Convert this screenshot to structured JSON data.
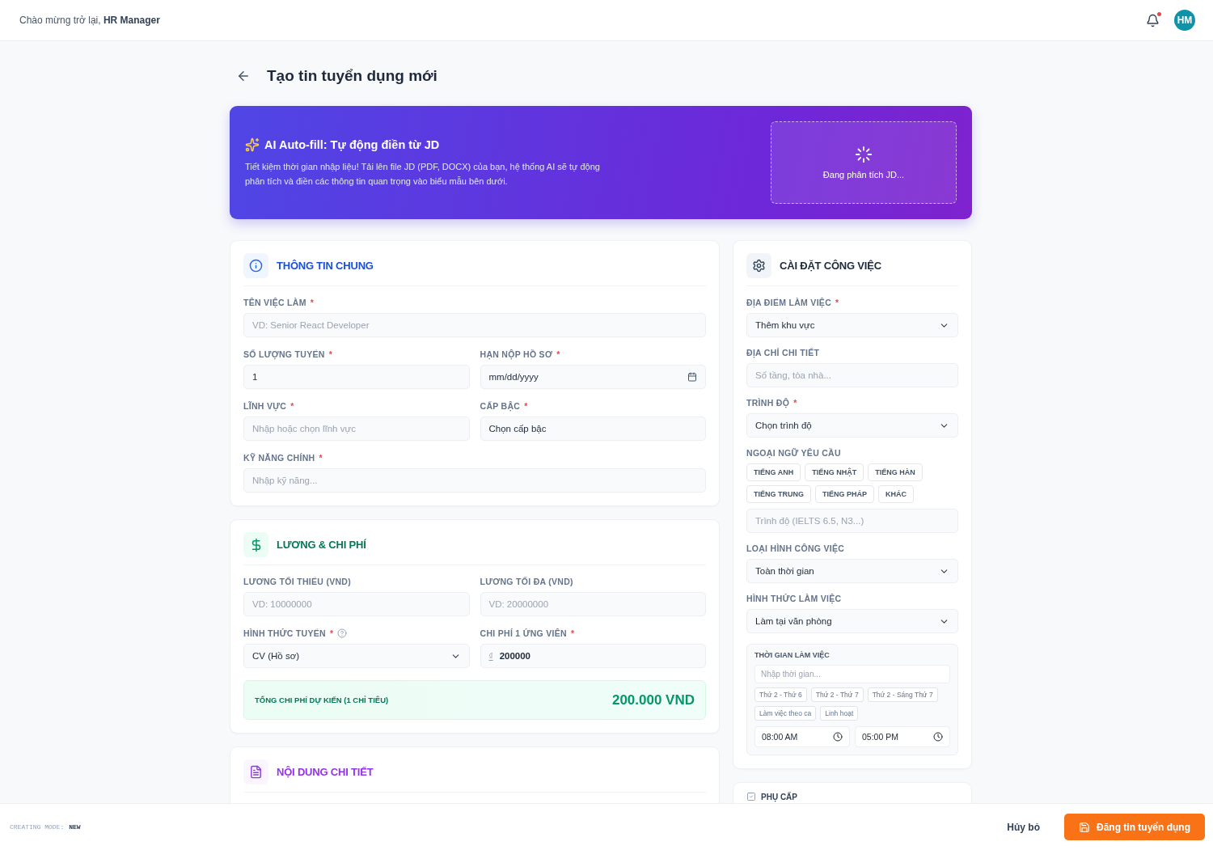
{
  "header": {
    "greeting": "Chào mừng trở lại, **HR Manager**",
    "has_notification": true,
    "avatar": "HM"
  },
  "page_title": "Tạo tin tuyển dụng mới",
  "ai_banner": {
    "title": "AI Auto-fill: Tự động điền từ JD",
    "description": "Tiết kiệm thời gian nhập liệu! Tải lên file JD (PDF, DOCX) của bạn, hệ thống AI sẽ tự động phân tích và điền các thông tin quan trọng vào biểu mẫu bên dưới.",
    "status": "Đang phân tích JD..."
  },
  "general": {
    "title": "THÔNG TIN CHUNG",
    "fields": [
      {
        "label": "TÊN VIỆC LÀM",
        "required_mark": "*",
        "kind": "text",
        "wide": true,
        "placeholder": "VD: Senior React Developer"
      },
      {
        "label": "SỐ LƯỢNG TUYỂN",
        "required_mark": "*",
        "kind": "text",
        "wide": false,
        "value": "1"
      },
      {
        "label": "HẠN NỘP HỒ SƠ",
        "required_mark": "*",
        "kind": "date",
        "wide": false,
        "value": "mm/dd/yyyy"
      },
      {
        "label": "LĨNH VỰC",
        "required_mark": "*",
        "kind": "text",
        "wide": false,
        "placeholder": "Nhập hoặc chọn lĩnh vực"
      },
      {
        "label": "CẤP BẬC",
        "required_mark": "*",
        "kind": "text",
        "wide": false,
        "value": "Chọn cấp bậc"
      },
      {
        "label": "KỸ NĂNG CHÍNH",
        "required_mark": "*",
        "kind": "text",
        "wide": true,
        "placeholder": "Nhập kỹ năng..."
      }
    ]
  },
  "salary": {
    "title": "LƯƠNG & CHI PHÍ",
    "fields": [
      {
        "label": "LƯƠNG TỐI THIỂU (VND)",
        "kind": "text",
        "placeholder": "VD: 10000000"
      },
      {
        "label": "LƯƠNG TỐI ĐA (VND)",
        "kind": "text",
        "placeholder": "VD: 20000000"
      },
      {
        "label": "HÌNH THỨC TUYỂN",
        "required_mark": "*",
        "help": true,
        "kind": "select",
        "value": "CV (Hồ sơ)"
      },
      {
        "label": "CHI PHÍ 1 ỨNG VIÊN",
        "required_mark": "*",
        "kind": "money",
        "prefix": "₫",
        "value": "200000"
      }
    ],
    "total": {
      "label": "TỔNG CHI PHÍ DỰ KIẾN (1 CHỈ TIÊU)",
      "amount": "200.000 VND"
    }
  },
  "detail": {
    "title": "NỘI DUNG CHI TIẾT"
  },
  "settings": {
    "title": "CÀI ĐẶT CÔNG VIỆC",
    "fields": [
      {
        "label": "ĐỊA ĐIỂM LÀM VIỆC",
        "required_mark": "*",
        "kind": "select",
        "value": "Thêm khu vực"
      },
      {
        "label": "ĐỊA CHỈ CHI TIẾT",
        "kind": "text",
        "placeholder": "Số tầng, tòa nhà..."
      },
      {
        "label": "TRÌNH ĐỘ",
        "required_mark": "*",
        "kind": "select",
        "value": "Chọn trình độ"
      },
      {
        "label": "NGOẠI NGỮ YÊU CẦU",
        "kind": "languages",
        "options": [
          {
            "label": "TIẾNG ANH",
            "selected": false
          },
          {
            "label": "TIẾNG NHẬT",
            "selected": false
          },
          {
            "label": "TIẾNG HÀN",
            "selected": false
          },
          {
            "label": "TIẾNG TRUNG",
            "selected": false
          },
          {
            "label": "TIẾNG PHÁP",
            "selected": false
          },
          {
            "label": "KHÁC",
            "selected": false
          }
        ],
        "placeholder": "Trình độ (IELTS 6.5, N3...)"
      },
      {
        "label": "LOẠI HÌNH CÔNG VIỆC",
        "kind": "select",
        "value": "Toàn thời gian"
      },
      {
        "label": "HÌNH THỨC LÀM VIỆC",
        "kind": "select",
        "value": "Làm tại văn phòng"
      }
    ],
    "schedule": {
      "title": "THỜI GIAN LÀM VIỆC",
      "placeholder": "Nhập thời gian...",
      "presets": [
        "Thứ 2 - Thứ 6",
        "Thứ 2 - Thứ 7",
        "Thứ 2 - Sáng Thứ 7",
        "Làm việc theo ca",
        "Linh hoạt"
      ],
      "start": "08:00 AM",
      "end": "05:00 PM"
    }
  },
  "allowance": {
    "title": "PHỤ CẤP"
  },
  "footer": {
    "mode_label": "CREATING MODE:",
    "mode_value": "NEW",
    "cancel": "Hủy bỏ",
    "submit": "Đăng tin tuyển dụng"
  }
}
